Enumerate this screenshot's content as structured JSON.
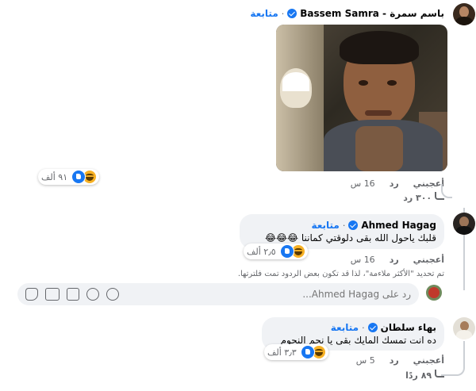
{
  "comments": [
    {
      "author": "باسم سمرة - Bassem Samra",
      "follow": "متابعة",
      "like": "أعجبني",
      "reply": "رد",
      "time": "16 س",
      "reaction_count": "٩١ ألف",
      "replies_link": "٣٠٠ رد"
    },
    {
      "author": "Ahmed Hagag",
      "follow": "متابعة",
      "text": "قلبك ياحول الله بقى دلوقتي كماننا 😂😂😂",
      "like": "أعجبني",
      "reply": "رد",
      "time": "16 س",
      "reaction_count": "٢٫٥ ألف"
    },
    {
      "author": "بهاء سلطان",
      "follow": "متابعة",
      "text": "ده انت تمسك المايك بقى يا نجم النجوم",
      "like": "أعجبني",
      "reply": "رد",
      "time": "5 س",
      "reaction_count": "٣٫٣ ألف",
      "replies_link": "٨٩ ردًا"
    }
  ],
  "filter_notice": "تم تحديد \"الأكثر ملاءمة\"، لذا قد تكون بعض الردود تمت فلترتها.",
  "reply_input": {
    "placeholder": "رد على Ahmed Hagag..."
  },
  "colors": {
    "accent": "#1877f2",
    "bubble": "#f0f2f5",
    "meta": "#65676b"
  }
}
